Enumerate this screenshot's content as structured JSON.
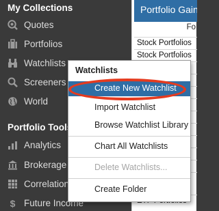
{
  "sidebar": {
    "section_collections": "My Collections",
    "collections_items": [
      {
        "label": "Quotes",
        "icon": "search-icon"
      },
      {
        "label": "Portfolios",
        "icon": "briefcase-icon"
      },
      {
        "label": "Watchlists",
        "icon": "binoculars-icon"
      },
      {
        "label": "Screeners",
        "icon": "magnifier-icon"
      },
      {
        "label": "World",
        "icon": "globe-icon"
      }
    ],
    "section_tools": "Portfolio Tools",
    "tools_items": [
      {
        "label": "Analytics",
        "icon": "bar-chart-icon"
      },
      {
        "label": "Brokerage Connect",
        "icon": "bank-icon"
      },
      {
        "label": "Correlation",
        "icon": "grid-icon"
      },
      {
        "label": "Future Income",
        "icon": "dollar-icon"
      }
    ]
  },
  "main": {
    "header": "Portfolio Gains",
    "column_header": "Fo",
    "rows": [
      "Stock Portfolios",
      "Stock Portfolios",
      "",
      "",
      "",
      "",
      "",
      "",
      "",
      "",
      "",
      "",
      "ETF Portfolios"
    ]
  },
  "menu": {
    "title": "Watchlists",
    "items": [
      {
        "label": "Create New Watchlist",
        "highlighted": true
      },
      {
        "label": "Import Watchlist"
      },
      {
        "label": "Browse Watchlist Library"
      },
      {
        "label": "Chart All Watchlists"
      },
      {
        "label": "Delete Watchlists...",
        "disabled": true
      },
      {
        "label": "Create Folder"
      }
    ]
  },
  "colors": {
    "sidebar_bg": "#3a3a3a",
    "accent_blue": "#2f6ea5",
    "annotation_red": "#e53b1f",
    "icon_gray": "#9b9b9b"
  }
}
